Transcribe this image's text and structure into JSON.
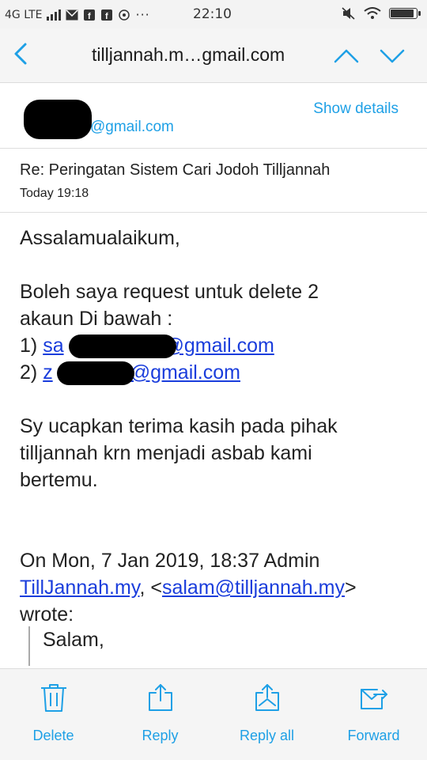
{
  "status_bar": {
    "network": "4G LTE",
    "time": "22:10",
    "battery_level": 0.9
  },
  "header": {
    "title": "tilljannah.m…gmail.com"
  },
  "sender": {
    "email_suffix": "@gmail.com",
    "show_details_label": "Show details"
  },
  "message": {
    "subject": "Re: Peringatan Sistem Cari Jodoh Tilljannah",
    "date": "Today 19:18",
    "greeting": "Assalamualaikum,",
    "request_line1": "Boleh saya request untuk delete 2",
    "request_line2": "akaun Di bawah :",
    "item1_prefix": "1) ",
    "item1_link_start": "sa",
    "item1_link_end": "n@gmail.com",
    "item2_prefix": "2) ",
    "item2_link_start": "z",
    "item2_link_end": "@gmail.com",
    "thanks_line1": "Sy ucapkan terima kasih pada pihak",
    "thanks_line2": "tilljannah krn menjadi asbab kami",
    "thanks_line3": "bertemu.",
    "quote_header_line1": "On Mon, 7 Jan 2019, 18:37 Admin",
    "quote_link1": "TillJannah.my",
    "quote_sep": ", <",
    "quote_link2": "salam@tilljannah.my",
    "quote_close": ">",
    "quote_header_line3": "wrote:",
    "quoted_text": "Salam,"
  },
  "toolbar": {
    "items": [
      {
        "label": "Delete",
        "icon": "trash-icon"
      },
      {
        "label": "Reply",
        "icon": "reply-icon"
      },
      {
        "label": "Reply all",
        "icon": "reply-all-icon"
      },
      {
        "label": "Forward",
        "icon": "forward-icon"
      }
    ]
  },
  "colors": {
    "accent": "#1ea0e6",
    "link": "#1a3ddc"
  }
}
